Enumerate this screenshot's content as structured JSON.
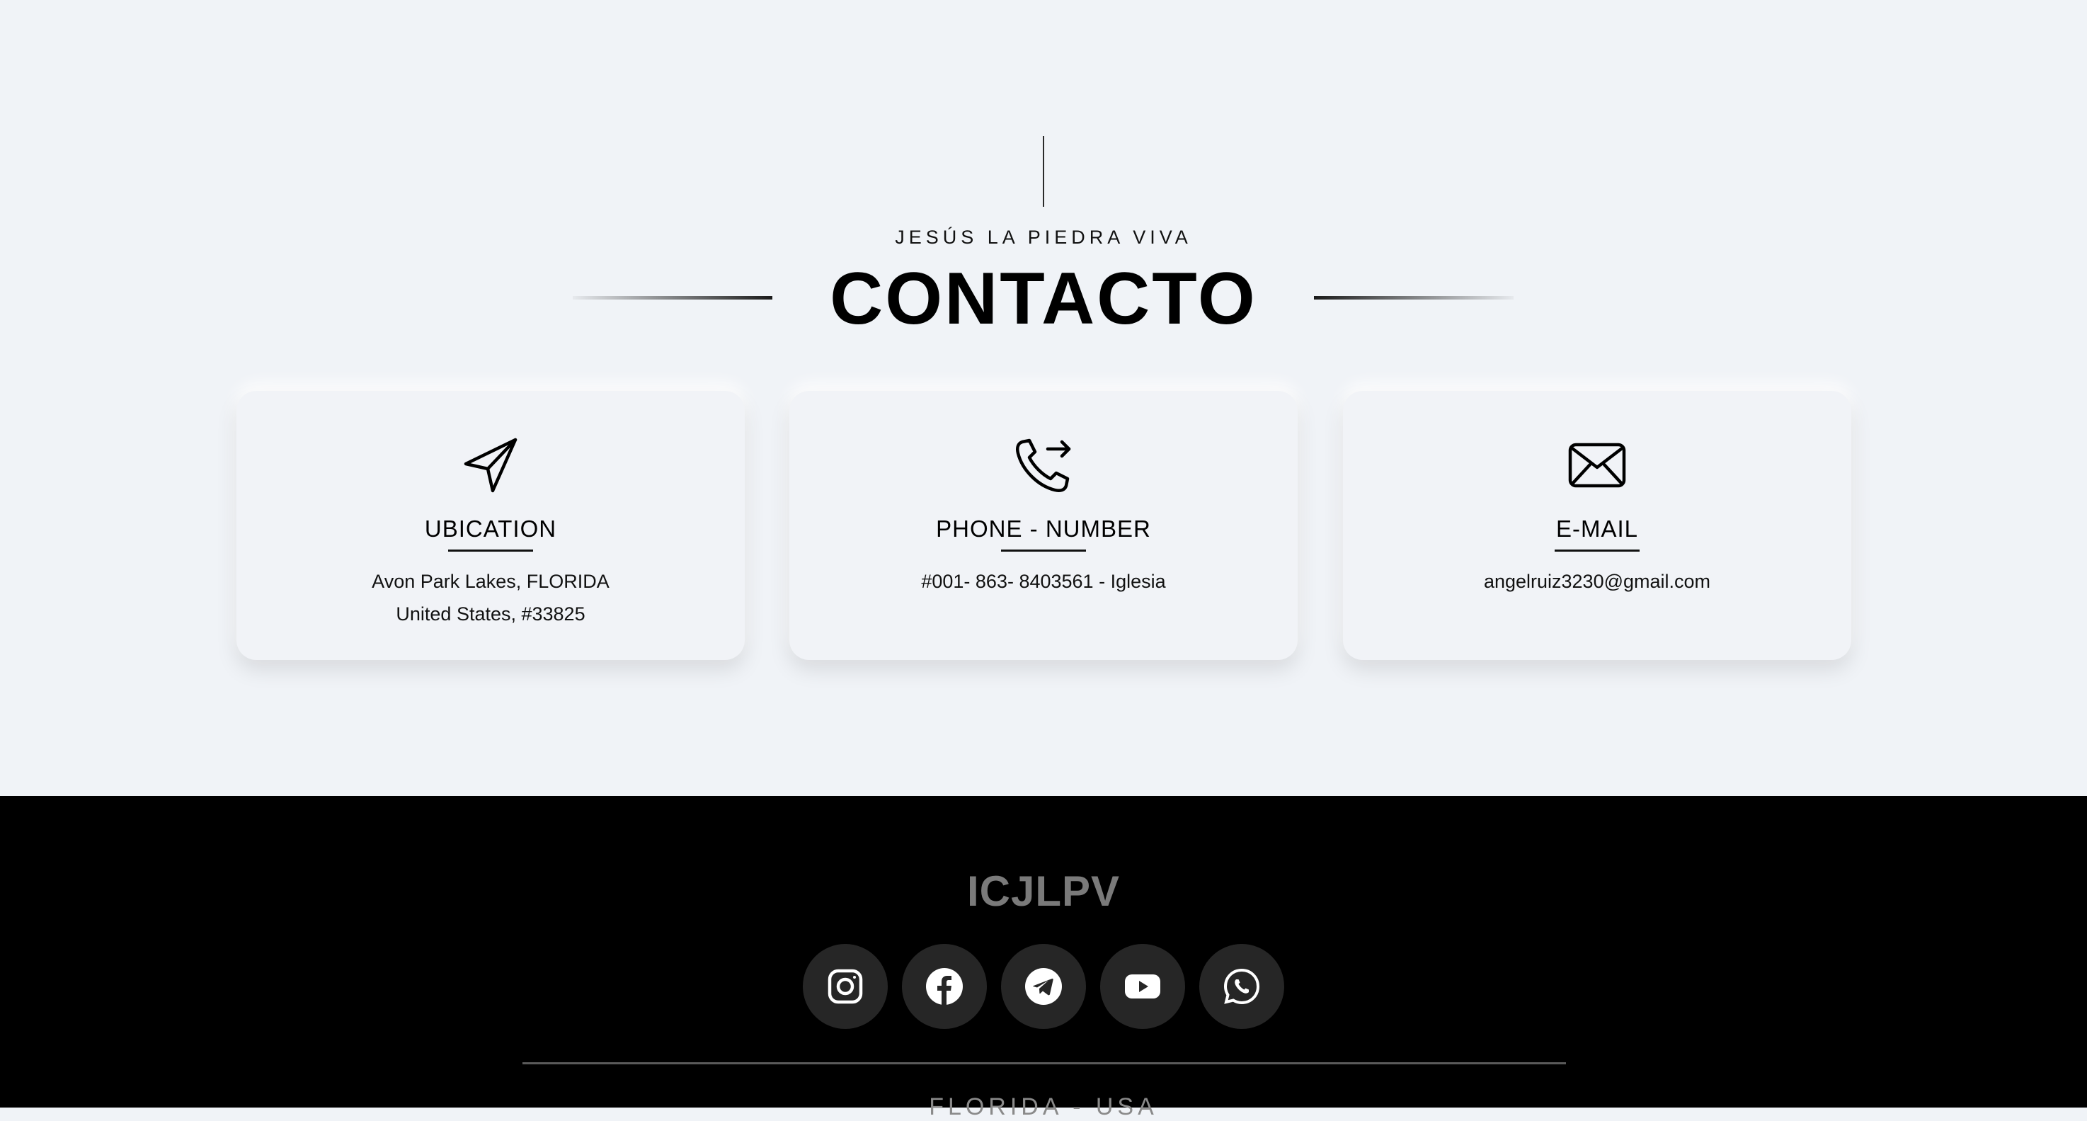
{
  "header": {
    "subtitle": "JESÚS LA PIEDRA VIVA",
    "title": "CONTACTO"
  },
  "cards": [
    {
      "icon": "paper-plane-icon",
      "title": "UBICATION",
      "lines": [
        "Avon Park Lakes, FLORIDA",
        "United States, #33825"
      ]
    },
    {
      "icon": "phone-outgoing-icon",
      "title": "PHONE - NUMBER",
      "lines": [
        "#001- 863- 8403561 - Iglesia"
      ]
    },
    {
      "icon": "envelope-icon",
      "title": "E-MAIL",
      "lines": [
        "angelruiz3230@gmail.com"
      ]
    }
  ],
  "footer": {
    "brand": "ICJLPV",
    "socials": [
      "instagram-icon",
      "facebook-icon",
      "telegram-icon",
      "youtube-icon",
      "whatsapp-icon"
    ],
    "location": "FLORIDA - USA"
  },
  "colors": {
    "page_background": "#f0f3f7",
    "footer_background": "#000000",
    "social_button": "#262626",
    "brand_text": "#7a7a7a"
  }
}
